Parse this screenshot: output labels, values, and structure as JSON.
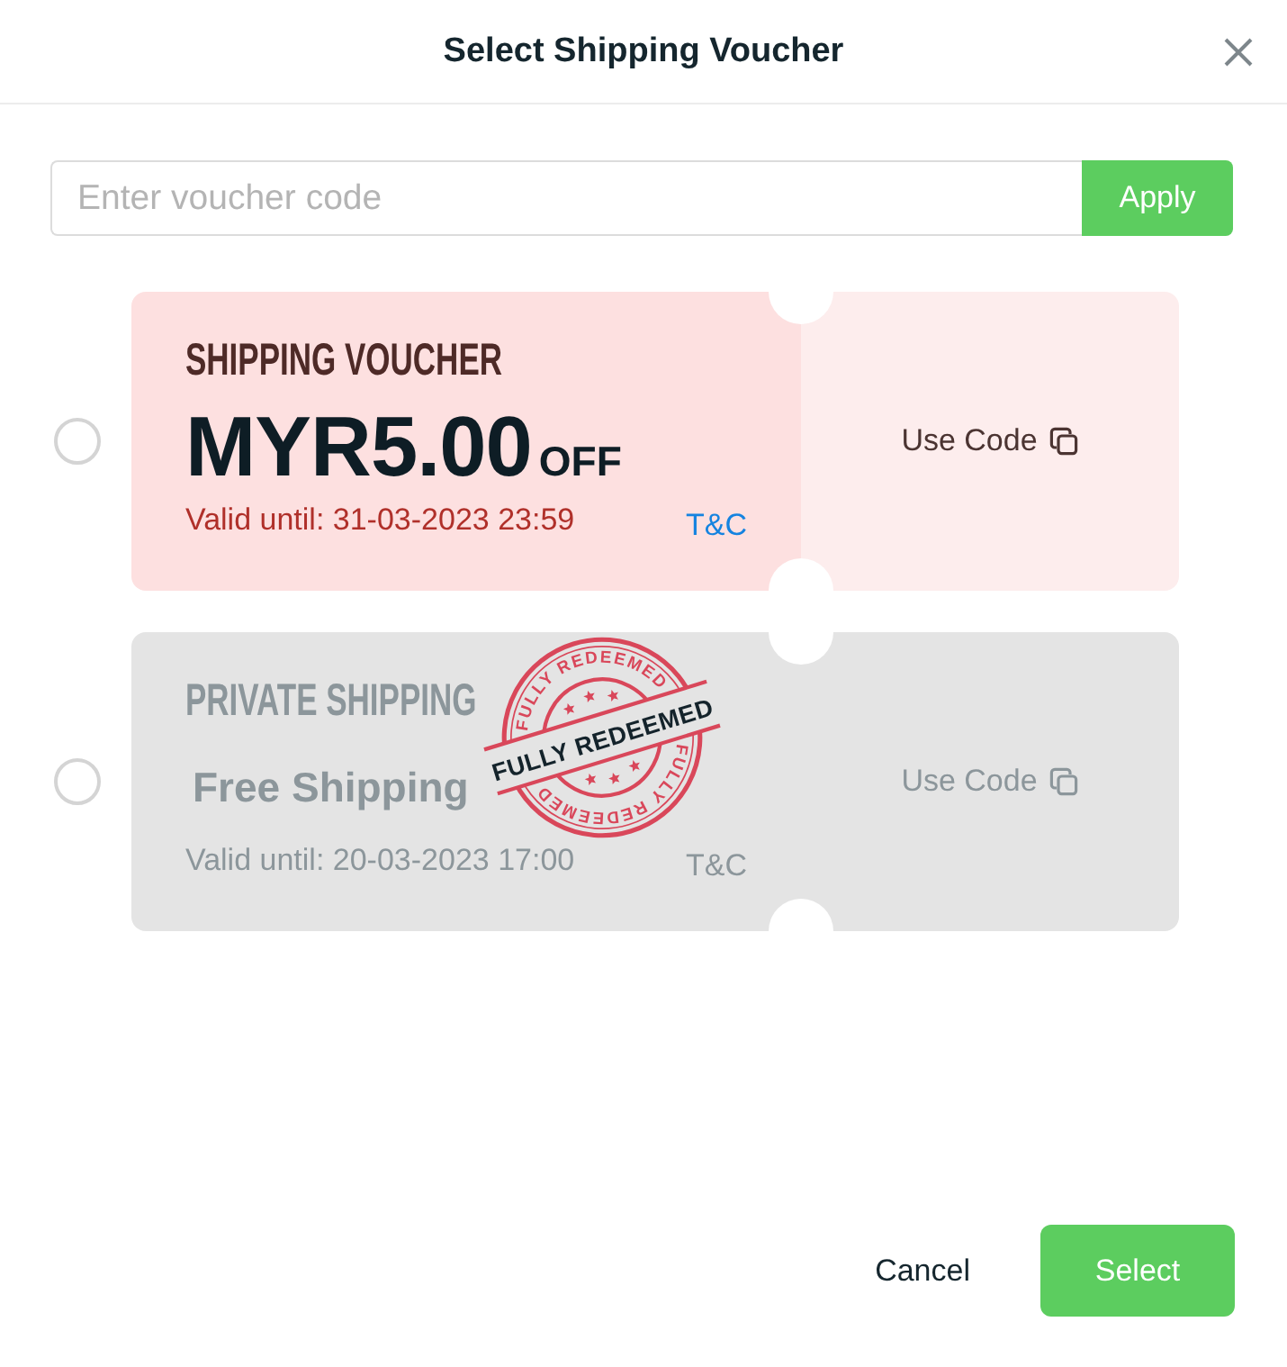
{
  "dialog": {
    "title": "Select Shipping Voucher"
  },
  "voucher_code": {
    "placeholder": "Enter voucher code",
    "apply_label": "Apply"
  },
  "vouchers": [
    {
      "kind": "discount",
      "selected": false,
      "redeemed": false,
      "title": "SHIPPING VOUCHER",
      "amount": "MYR5.00",
      "amount_suffix": "OFF",
      "valid_until": "Valid until: 31-03-2023 23:59",
      "terms": "T&C",
      "use_code": "Use Code"
    },
    {
      "kind": "free_shipping",
      "selected": false,
      "redeemed": true,
      "title": "PRIVATE SHIPPING",
      "amount": "Free Shipping",
      "valid_until": "Valid until: 20-03-2023 17:00",
      "terms": "T&C",
      "use_code": "Use Code",
      "stamp": {
        "band": "FULLY REDEEMED",
        "ring_top": "FULLY REDEEMED",
        "ring_bottom": "FULLY REDEEMED"
      }
    }
  ],
  "footer": {
    "cancel": "Cancel",
    "select": "Select"
  }
}
